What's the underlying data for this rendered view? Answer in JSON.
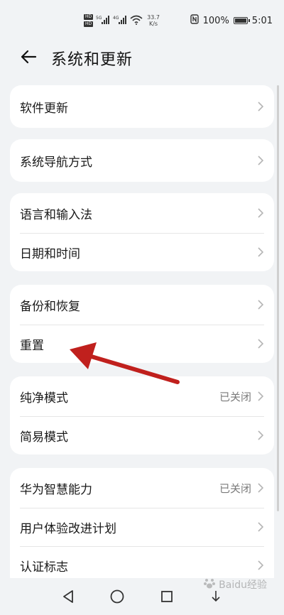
{
  "status_bar": {
    "hd1": "HD",
    "hd2": "HD",
    "sig1_label": "5G",
    "sig2_label": "4G",
    "speed_value": "33.7",
    "speed_unit": "K/s",
    "battery": "100%",
    "time": "5:01"
  },
  "header": {
    "title": "系统和更新"
  },
  "groups": [
    {
      "items": [
        {
          "label": "软件更新",
          "value": ""
        }
      ]
    },
    {
      "items": [
        {
          "label": "系统导航方式",
          "value": ""
        }
      ]
    },
    {
      "items": [
        {
          "label": "语言和输入法",
          "value": ""
        },
        {
          "label": "日期和时间",
          "value": ""
        }
      ]
    },
    {
      "items": [
        {
          "label": "备份和恢复",
          "value": ""
        },
        {
          "label": "重置",
          "value": ""
        }
      ]
    },
    {
      "items": [
        {
          "label": "纯净模式",
          "value": "已关闭"
        },
        {
          "label": "简易模式",
          "value": ""
        }
      ]
    },
    {
      "items": [
        {
          "label": "华为智慧能力",
          "value": "已关闭"
        },
        {
          "label": "用户体验改进计划",
          "value": ""
        },
        {
          "label": "认证标志",
          "value": ""
        }
      ]
    }
  ],
  "annotation": {
    "color": "#c0201d",
    "target": "重置"
  },
  "colors": {
    "background": "#f1f3f5",
    "card": "#ffffff",
    "secondary_text": "#7a7a7a"
  },
  "watermark": "Baidu经验"
}
